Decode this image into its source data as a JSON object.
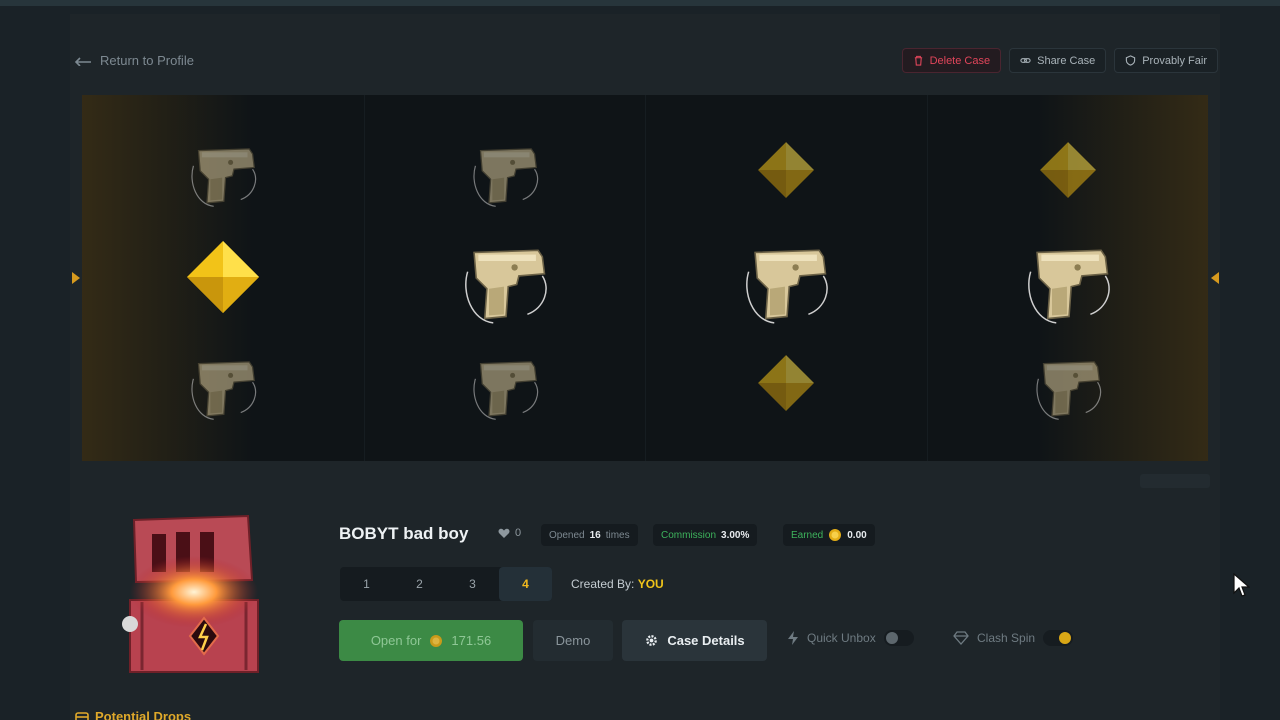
{
  "nav": {
    "return_label": "Return to Profile"
  },
  "actions": {
    "delete_label": "Delete Case",
    "share_label": "Share Case",
    "provably_label": "Provably Fair"
  },
  "case": {
    "title": "BOBYT bad boy",
    "likes": "0",
    "opened_prefix": "Opened",
    "opened_count": "16",
    "opened_suffix": "times",
    "commission_label": "Commission",
    "commission_value": "3.00%",
    "earned_label": "Earned",
    "earned_value": "0.00",
    "quantity_options": [
      "1",
      "2",
      "3",
      "4"
    ],
    "quantity_selected": "4",
    "created_label": "Created By:",
    "created_value": "YOU"
  },
  "buttons": {
    "open_label": "Open for",
    "open_price": "171.56",
    "demo_label": "Demo",
    "details_label": "Case Details",
    "quick_unbox_label": "Quick Unbox",
    "clash_spin_label": "Clash Spin"
  },
  "toggles": {
    "quick_unbox": false,
    "clash_spin": true
  },
  "sections": {
    "potential_drops": "Potential Drops"
  },
  "reels": [
    [
      "pistol-icon",
      "gem-icon",
      "pistol-icon"
    ],
    [
      "pistol-icon",
      "pistol-icon",
      "pistol-icon"
    ],
    [
      "gem-icon",
      "pistol-icon",
      "gem-icon"
    ],
    [
      "gem-icon",
      "pistol-icon",
      "pistol-icon"
    ]
  ],
  "colors": {
    "accent": "#f0b81e",
    "danger": "#e0455a",
    "success": "#3c8a45",
    "gem": "#f4c21a"
  }
}
